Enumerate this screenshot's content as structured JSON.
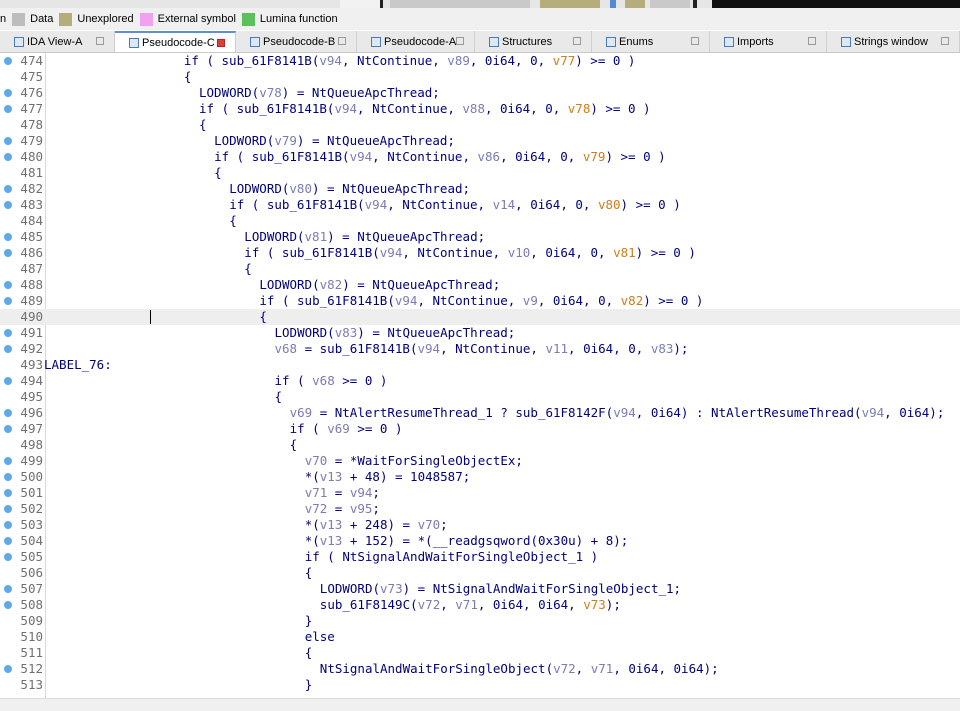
{
  "legend": [
    {
      "name": "legend-data",
      "swatch": "#bdbdbd",
      "label": "Data"
    },
    {
      "name": "legend-unexplored",
      "swatch": "#b5ad7c",
      "label": "Unexplored"
    },
    {
      "name": "legend-external-symbol",
      "swatch": "#f1a1f1",
      "label": "External symbol"
    },
    {
      "name": "legend-lumina-function",
      "swatch": "#5cc15c",
      "label": "Lumina function"
    }
  ],
  "legend_prefix": "n",
  "tabs": [
    {
      "label": "IDA View-A",
      "w": 115,
      "active": false
    },
    {
      "label": "Pseudocode-C",
      "w": 121,
      "active": true
    },
    {
      "label": "Pseudocode-B",
      "w": 121,
      "active": false
    },
    {
      "label": "Pseudocode-A",
      "w": 118,
      "active": false
    },
    {
      "label": "Structures",
      "w": 117,
      "active": false
    },
    {
      "label": "Enums",
      "w": 118,
      "active": false
    },
    {
      "label": "Imports",
      "w": 117,
      "active": false
    },
    {
      "label": "Strings window",
      "w": 133,
      "active": false
    }
  ],
  "colors": {
    "number": "#000080",
    "variable": "#7b7bb8",
    "arg_highlight": "#d47b15",
    "breakpoint": "#5fa9e6"
  },
  "lines": [
    {
      "num": "474",
      "bp": true,
      "indent": 18,
      "tokens": [
        [
          "n",
          "if ( sub_61F8141B("
        ],
        [
          "v",
          "v94"
        ],
        [
          "n",
          ", NtContinue, "
        ],
        [
          "v",
          "v89"
        ],
        [
          "n",
          ", 0i64, 0, "
        ],
        [
          "a",
          "v77"
        ],
        [
          "n",
          ") >= 0 )"
        ]
      ]
    },
    {
      "num": "475",
      "bp": false,
      "indent": 18,
      "tokens": [
        [
          "n",
          "{"
        ]
      ]
    },
    {
      "num": "476",
      "bp": true,
      "indent": 20,
      "tokens": [
        [
          "n",
          "LODWORD("
        ],
        [
          "v",
          "v78"
        ],
        [
          "n",
          ") = NtQueueApcThread;"
        ]
      ]
    },
    {
      "num": "477",
      "bp": true,
      "indent": 20,
      "tokens": [
        [
          "n",
          "if ( sub_61F8141B("
        ],
        [
          "v",
          "v94"
        ],
        [
          "n",
          ", NtContinue, "
        ],
        [
          "v",
          "v88"
        ],
        [
          "n",
          ", 0i64, 0, "
        ],
        [
          "a",
          "v78"
        ],
        [
          "n",
          ") >= 0 )"
        ]
      ]
    },
    {
      "num": "478",
      "bp": false,
      "indent": 20,
      "tokens": [
        [
          "n",
          "{"
        ]
      ]
    },
    {
      "num": "479",
      "bp": true,
      "indent": 22,
      "tokens": [
        [
          "n",
          "LODWORD("
        ],
        [
          "v",
          "v79"
        ],
        [
          "n",
          ") = NtQueueApcThread;"
        ]
      ]
    },
    {
      "num": "480",
      "bp": true,
      "indent": 22,
      "tokens": [
        [
          "n",
          "if ( sub_61F8141B("
        ],
        [
          "v",
          "v94"
        ],
        [
          "n",
          ", NtContinue, "
        ],
        [
          "v",
          "v86"
        ],
        [
          "n",
          ", 0i64, 0, "
        ],
        [
          "a",
          "v79"
        ],
        [
          "n",
          ") >= 0 )"
        ]
      ]
    },
    {
      "num": "481",
      "bp": false,
      "indent": 22,
      "tokens": [
        [
          "n",
          "{"
        ]
      ]
    },
    {
      "num": "482",
      "bp": true,
      "indent": 24,
      "tokens": [
        [
          "n",
          "LODWORD("
        ],
        [
          "v",
          "v80"
        ],
        [
          "n",
          ") = NtQueueApcThread;"
        ]
      ]
    },
    {
      "num": "483",
      "bp": true,
      "indent": 24,
      "tokens": [
        [
          "n",
          "if ( sub_61F8141B("
        ],
        [
          "v",
          "v94"
        ],
        [
          "n",
          ", NtContinue, "
        ],
        [
          "v",
          "v14"
        ],
        [
          "n",
          ", 0i64, 0, "
        ],
        [
          "a",
          "v80"
        ],
        [
          "n",
          ") >= 0 )"
        ]
      ]
    },
    {
      "num": "484",
      "bp": false,
      "indent": 24,
      "tokens": [
        [
          "n",
          "{"
        ]
      ]
    },
    {
      "num": "485",
      "bp": true,
      "indent": 26,
      "tokens": [
        [
          "n",
          "LODWORD("
        ],
        [
          "v",
          "v81"
        ],
        [
          "n",
          ") = NtQueueApcThread;"
        ]
      ]
    },
    {
      "num": "486",
      "bp": true,
      "indent": 26,
      "tokens": [
        [
          "n",
          "if ( sub_61F8141B("
        ],
        [
          "v",
          "v94"
        ],
        [
          "n",
          ", NtContinue, "
        ],
        [
          "v",
          "v10"
        ],
        [
          "n",
          ", 0i64, 0, "
        ],
        [
          "a",
          "v81"
        ],
        [
          "n",
          ") >= 0 )"
        ]
      ]
    },
    {
      "num": "487",
      "bp": false,
      "indent": 26,
      "tokens": [
        [
          "n",
          "{"
        ]
      ]
    },
    {
      "num": "488",
      "bp": true,
      "indent": 28,
      "tokens": [
        [
          "n",
          "LODWORD("
        ],
        [
          "v",
          "v82"
        ],
        [
          "n",
          ") = NtQueueApcThread;"
        ]
      ]
    },
    {
      "num": "489",
      "bp": true,
      "indent": 28,
      "tokens": [
        [
          "n",
          "if ( sub_61F8141B("
        ],
        [
          "v",
          "v94"
        ],
        [
          "n",
          ", NtContinue, "
        ],
        [
          "v",
          "v9"
        ],
        [
          "n",
          ", 0i64, 0, "
        ],
        [
          "a",
          "v82"
        ],
        [
          "n",
          ") >= 0 )"
        ]
      ]
    },
    {
      "num": "490",
      "bp": false,
      "cur": true,
      "indent": 28,
      "tokens": [
        [
          "n",
          "{"
        ]
      ]
    },
    {
      "num": "491",
      "bp": true,
      "indent": 30,
      "tokens": [
        [
          "n",
          "LODWORD("
        ],
        [
          "v",
          "v83"
        ],
        [
          "n",
          ") = NtQueueApcThread;"
        ]
      ]
    },
    {
      "num": "492",
      "bp": true,
      "indent": 30,
      "tokens": [
        [
          "v",
          "v68"
        ],
        [
          "n",
          " = sub_61F8141B("
        ],
        [
          "v",
          "v94"
        ],
        [
          "n",
          ", NtContinue, "
        ],
        [
          "v",
          "v11"
        ],
        [
          "n",
          ", 0i64, 0, "
        ],
        [
          "v",
          "v83"
        ],
        [
          "n",
          ");"
        ]
      ]
    },
    {
      "num": "493",
      "bp": false,
      "label": "LABEL_76:",
      "indent": 0,
      "tokens": []
    },
    {
      "num": "494",
      "bp": true,
      "indent": 30,
      "tokens": [
        [
          "n",
          "if ( "
        ],
        [
          "v",
          "v68"
        ],
        [
          "n",
          " >= 0 )"
        ]
      ]
    },
    {
      "num": "495",
      "bp": false,
      "indent": 30,
      "tokens": [
        [
          "n",
          "{"
        ]
      ]
    },
    {
      "num": "496",
      "bp": true,
      "indent": 32,
      "tokens": [
        [
          "v",
          "v69"
        ],
        [
          "n",
          " = NtAlertResumeThread_1 ? sub_61F8142F("
        ],
        [
          "v",
          "v94"
        ],
        [
          "n",
          ", 0i64) : NtAlertResumeThread("
        ],
        [
          "v",
          "v94"
        ],
        [
          "n",
          ", 0i64);"
        ]
      ]
    },
    {
      "num": "497",
      "bp": true,
      "indent": 32,
      "tokens": [
        [
          "n",
          "if ( "
        ],
        [
          "v",
          "v69"
        ],
        [
          "n",
          " >= 0 )"
        ]
      ]
    },
    {
      "num": "498",
      "bp": false,
      "indent": 32,
      "tokens": [
        [
          "n",
          "{"
        ]
      ]
    },
    {
      "num": "499",
      "bp": true,
      "indent": 34,
      "tokens": [
        [
          "v",
          "v70"
        ],
        [
          "n",
          " = *WaitForSingleObjectEx;"
        ]
      ]
    },
    {
      "num": "500",
      "bp": true,
      "indent": 34,
      "tokens": [
        [
          "n",
          "*("
        ],
        [
          "v",
          "v13"
        ],
        [
          "n",
          " + 48) = 1048587;"
        ]
      ]
    },
    {
      "num": "501",
      "bp": true,
      "indent": 34,
      "tokens": [
        [
          "v",
          "v71"
        ],
        [
          "n",
          " = "
        ],
        [
          "v",
          "v94"
        ],
        [
          "n",
          ";"
        ]
      ]
    },
    {
      "num": "502",
      "bp": true,
      "indent": 34,
      "tokens": [
        [
          "v",
          "v72"
        ],
        [
          "n",
          " = "
        ],
        [
          "v",
          "v95"
        ],
        [
          "n",
          ";"
        ]
      ]
    },
    {
      "num": "503",
      "bp": true,
      "indent": 34,
      "tokens": [
        [
          "n",
          "*("
        ],
        [
          "v",
          "v13"
        ],
        [
          "n",
          " + 248) = "
        ],
        [
          "v",
          "v70"
        ],
        [
          "n",
          ";"
        ]
      ]
    },
    {
      "num": "504",
      "bp": true,
      "indent": 34,
      "tokens": [
        [
          "n",
          "*("
        ],
        [
          "v",
          "v13"
        ],
        [
          "n",
          " + 152) = *(__readgsqword(0x30u) + 8);"
        ]
      ]
    },
    {
      "num": "505",
      "bp": true,
      "indent": 34,
      "tokens": [
        [
          "n",
          "if ( NtSignalAndWaitForSingleObject_1 )"
        ]
      ]
    },
    {
      "num": "506",
      "bp": false,
      "indent": 34,
      "tokens": [
        [
          "n",
          "{"
        ]
      ]
    },
    {
      "num": "507",
      "bp": true,
      "indent": 36,
      "tokens": [
        [
          "n",
          "LODWORD("
        ],
        [
          "v",
          "v73"
        ],
        [
          "n",
          ") = NtSignalAndWaitForSingleObject_1;"
        ]
      ]
    },
    {
      "num": "508",
      "bp": true,
      "indent": 36,
      "tokens": [
        [
          "n",
          "sub_61F8149C("
        ],
        [
          "v",
          "v72"
        ],
        [
          "n",
          ", "
        ],
        [
          "v",
          "v71"
        ],
        [
          "n",
          ", 0i64, 0i64, "
        ],
        [
          "a",
          "v73"
        ],
        [
          "n",
          ");"
        ]
      ]
    },
    {
      "num": "509",
      "bp": false,
      "indent": 34,
      "tokens": [
        [
          "n",
          "}"
        ]
      ]
    },
    {
      "num": "510",
      "bp": false,
      "indent": 34,
      "tokens": [
        [
          "n",
          "else"
        ]
      ]
    },
    {
      "num": "511",
      "bp": false,
      "indent": 34,
      "tokens": [
        [
          "n",
          "{"
        ]
      ]
    },
    {
      "num": "512",
      "bp": true,
      "indent": 36,
      "tokens": [
        [
          "n",
          "NtSignalAndWaitForSingleObject("
        ],
        [
          "v",
          "v72"
        ],
        [
          "n",
          ", "
        ],
        [
          "v",
          "v71"
        ],
        [
          "n",
          ", 0i64, 0i64);"
        ]
      ]
    },
    {
      "num": "513",
      "bp": false,
      "indent": 34,
      "tokens": [
        [
          "n",
          "}"
        ]
      ]
    }
  ]
}
